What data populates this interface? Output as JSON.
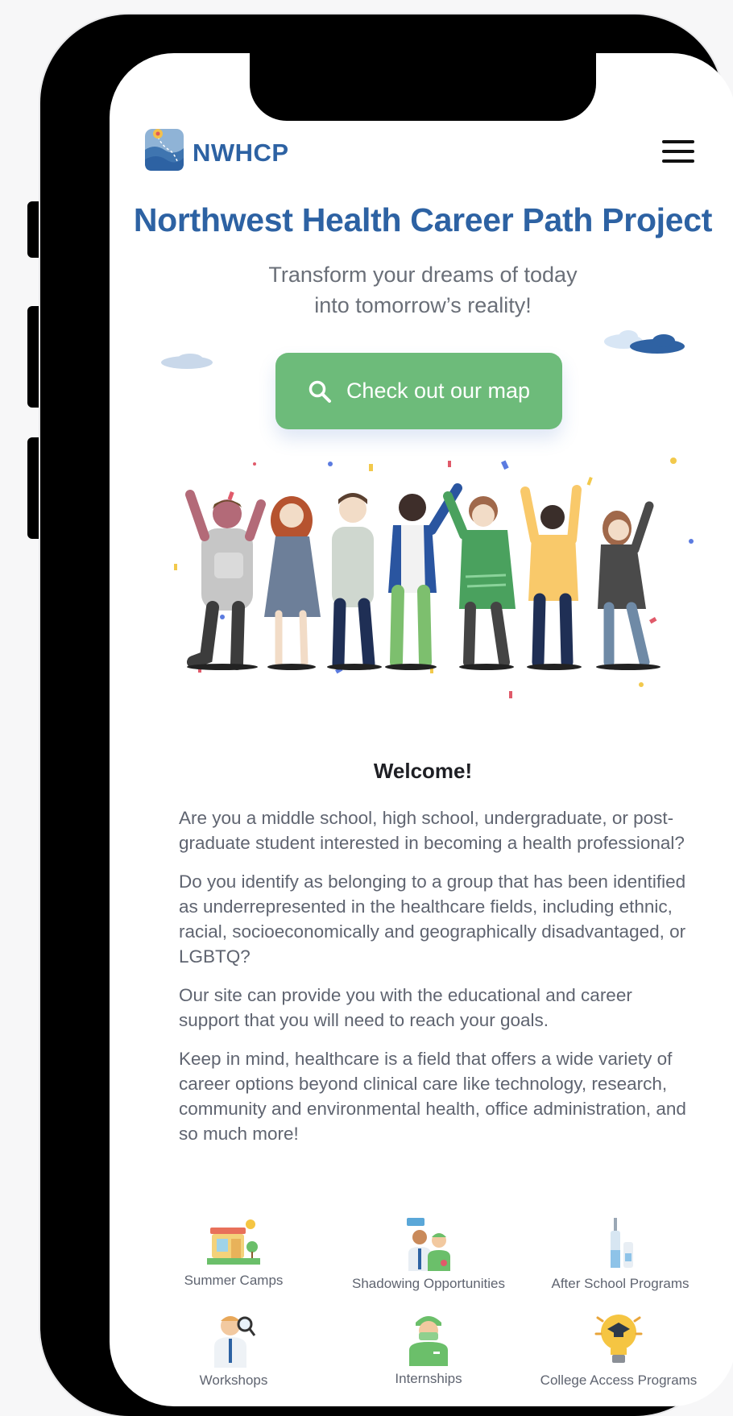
{
  "header": {
    "brand": "NWHCP",
    "logo_icon": "map-pin-landscape-icon",
    "menu_icon": "hamburger-menu-icon"
  },
  "hero": {
    "title": "Northwest Health Career Path Project",
    "subtitle_line1": "Transform your dreams of today",
    "subtitle_line2": "into tomorrow’s reality!",
    "cta_label": "Check out our map",
    "cta_icon": "search-icon"
  },
  "welcome": {
    "heading": "Welcome!",
    "paragraphs": [
      "Are you a middle school, high school, undergraduate, or post-graduate student interested in becoming a health professional?",
      "Do you identify as belonging to a group that has been identified as underrepresented in the healthcare fields, including ethnic, racial, socioeconomically and geographically disadvantaged, or LGBTQ?",
      "Our site can provide you with the educational and career support that you will need to reach your goals.",
      "Keep in mind, healthcare is a field that offers a wide variety of career options beyond clinical care like technology, research, community and environmental health, office administration, and so much more!"
    ]
  },
  "programs": [
    {
      "label": "Summer Camps",
      "icon": "summer-camp-icon"
    },
    {
      "label": "Shadowing Opportunities",
      "icon": "shadowing-icon"
    },
    {
      "label": "After School Programs",
      "icon": "lab-bottles-icon"
    },
    {
      "label": "Workshops",
      "icon": "workshop-doctor-icon"
    },
    {
      "label": "Internships",
      "icon": "surgeon-icon"
    },
    {
      "label": "College Access Programs",
      "icon": "lightbulb-graduation-icon"
    }
  ],
  "colors": {
    "brand_blue": "#2d62a3",
    "cta_green": "#6dbb7a",
    "body_text": "#5f6470"
  }
}
